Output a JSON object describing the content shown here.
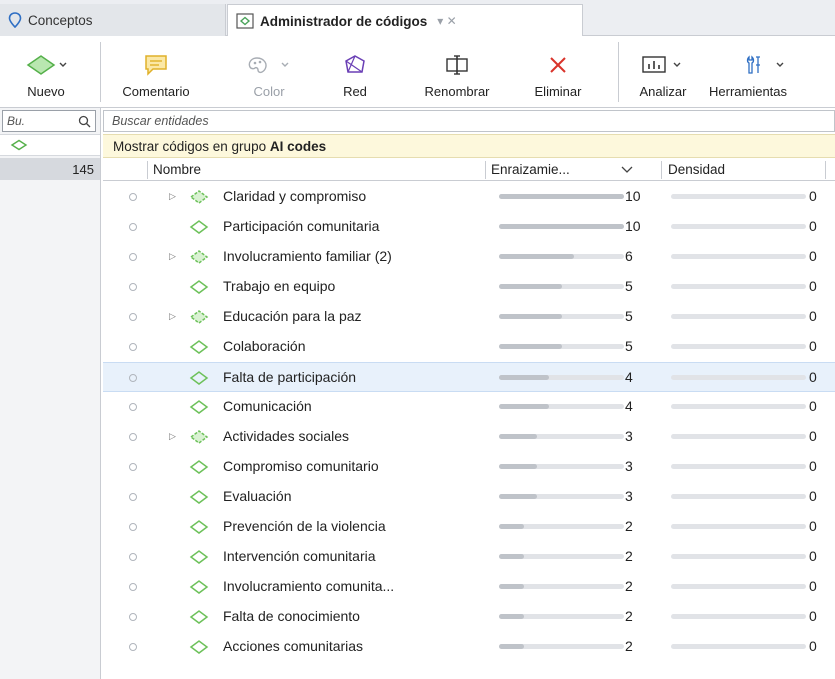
{
  "tabs": [
    {
      "label": "Conceptos",
      "icon": "conceptos-icon"
    },
    {
      "label": "Administrador de códigos",
      "icon": "codes-manager-icon",
      "extras": "▾  ✕"
    }
  ],
  "ribbon": {
    "nuevo": "Nuevo",
    "comentario": "Comentario",
    "color": "Color",
    "red": "Red",
    "renombrar": "Renombrar",
    "eliminar": "Eliminar",
    "analizar": "Analizar",
    "herramientas": "Herramientas"
  },
  "left_panel": {
    "search_placeholder": "Bu.",
    "count": "145"
  },
  "search": {
    "placeholder": "Buscar entidades"
  },
  "group_bar": {
    "prefix": "Mostrar códigos en grupo",
    "group": "AI codes"
  },
  "columns": {
    "name": "Nombre",
    "grounding": "Enraizamie...",
    "density": "Densidad"
  },
  "colors": {
    "code_green": "#6dc15a",
    "bar_fill": "#bfc3c9",
    "bar_track": "#e1e3e7",
    "selected": "#e8f1fb",
    "group_bar": "#fdf8dc"
  },
  "rows": [
    {
      "name": "Claridad y compromiso",
      "grounding": 10,
      "density": 0,
      "has_children": true
    },
    {
      "name": "Participación comunitaria",
      "grounding": 10,
      "density": 0,
      "has_children": false
    },
    {
      "name": "Involucramiento familiar (2)",
      "grounding": 6,
      "density": 0,
      "has_children": true
    },
    {
      "name": "Trabajo en equipo",
      "grounding": 5,
      "density": 0,
      "has_children": false
    },
    {
      "name": "Educación para la paz",
      "grounding": 5,
      "density": 0,
      "has_children": true
    },
    {
      "name": "Colaboración",
      "grounding": 5,
      "density": 0,
      "has_children": false
    },
    {
      "name": "Falta de participación",
      "grounding": 4,
      "density": 0,
      "has_children": false,
      "selected": true
    },
    {
      "name": "Comunicación",
      "grounding": 4,
      "density": 0,
      "has_children": false
    },
    {
      "name": "Actividades sociales",
      "grounding": 3,
      "density": 0,
      "has_children": true
    },
    {
      "name": "Compromiso comunitario",
      "grounding": 3,
      "density": 0,
      "has_children": false
    },
    {
      "name": "Evaluación",
      "grounding": 3,
      "density": 0,
      "has_children": false
    },
    {
      "name": "Prevención de la violencia",
      "grounding": 2,
      "density": 0,
      "has_children": false
    },
    {
      "name": "Intervención comunitaria",
      "grounding": 2,
      "density": 0,
      "has_children": false
    },
    {
      "name": "Involucramiento comunita...",
      "grounding": 2,
      "density": 0,
      "has_children": false
    },
    {
      "name": "Falta de conocimiento",
      "grounding": 2,
      "density": 0,
      "has_children": false
    },
    {
      "name": "Acciones comunitarias",
      "grounding": 2,
      "density": 0,
      "has_children": false
    }
  ]
}
